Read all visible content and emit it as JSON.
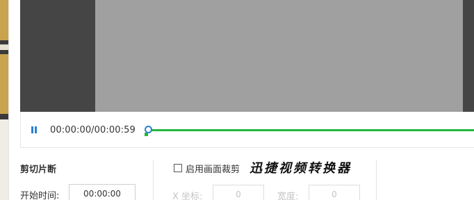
{
  "player": {
    "time_readout": "00:00:00/00:00:59",
    "progress_fraction": 0.0
  },
  "cut_section": {
    "title": "剪切片断",
    "start_label": "开始时间:",
    "start_value": "00:00:00"
  },
  "crop_section": {
    "checkbox_label": "启用画面裁剪",
    "checked": false,
    "x_label": "X 坐标:",
    "x_value": "0",
    "width_label": "宽度:",
    "width_value": "0"
  },
  "watermark": {
    "text": "迅捷视频转换器"
  },
  "colors": {
    "accent_blue": "#2a7fd4",
    "progress_green": "#22b83a",
    "preview_dark": "#454545",
    "video_gray": "#a0a0a0"
  },
  "icons": {
    "pause": "pause-icon",
    "checkbox": "checkbox-icon"
  }
}
